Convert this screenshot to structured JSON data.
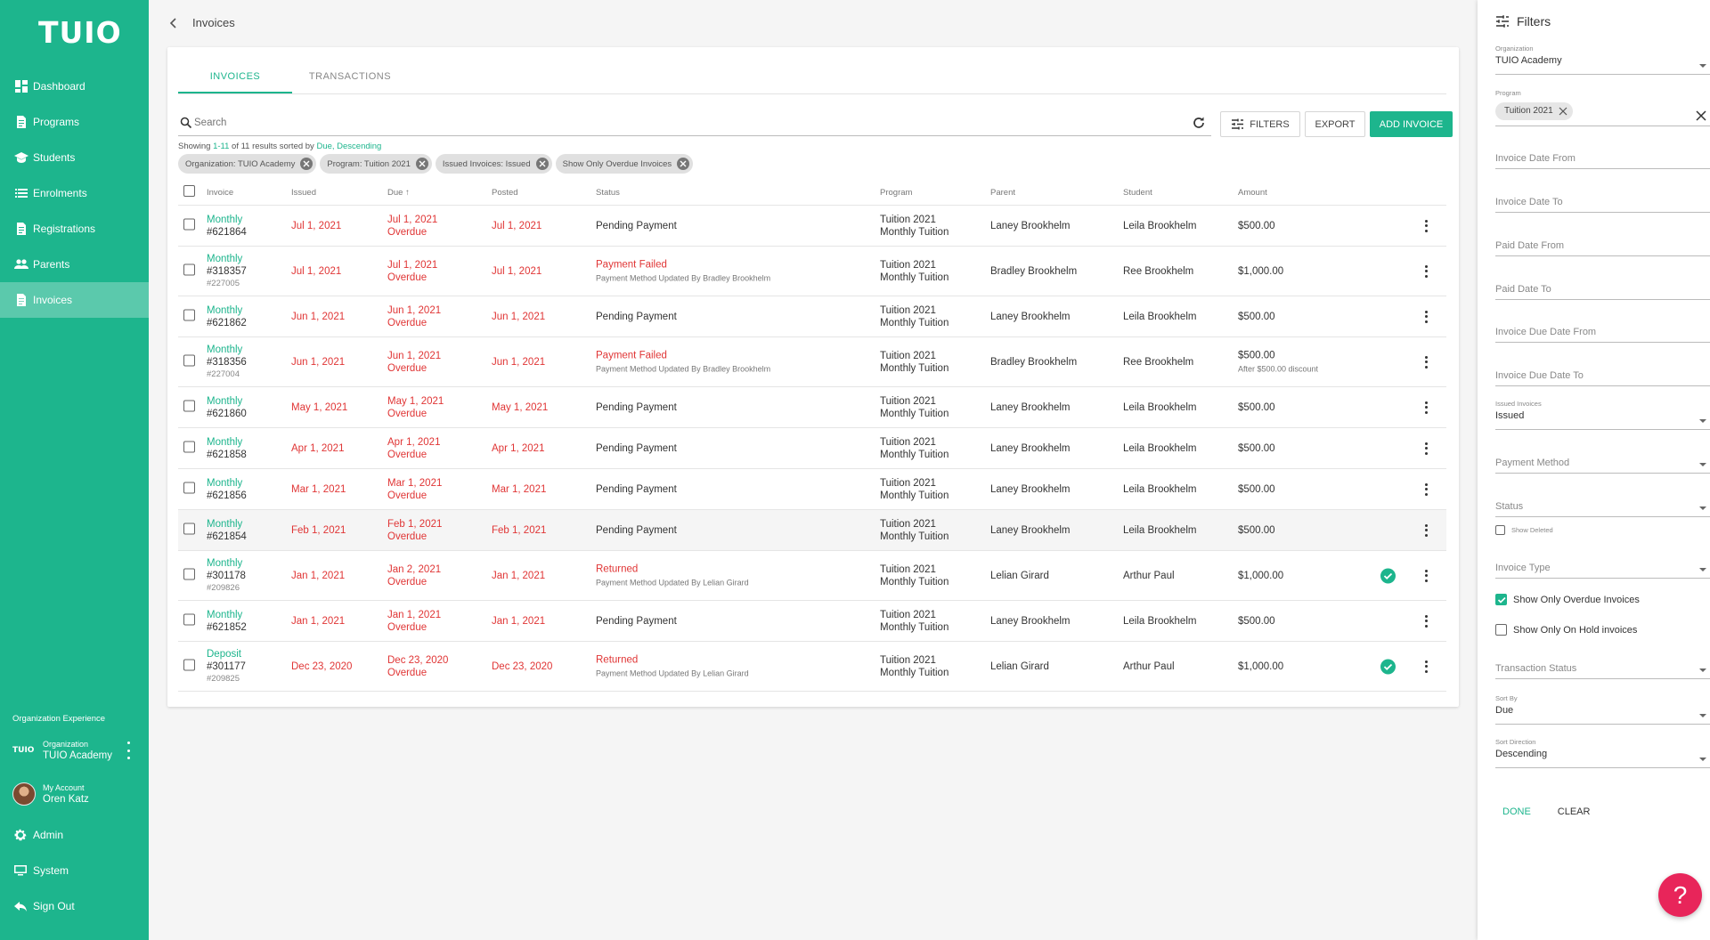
{
  "app": {
    "logo": "TUIO"
  },
  "sidebar": {
    "items": [
      {
        "label": "Dashboard",
        "icon": "dashboard-icon"
      },
      {
        "label": "Programs",
        "icon": "document-icon"
      },
      {
        "label": "Students",
        "icon": "graduation-cap-icon"
      },
      {
        "label": "Enrolments",
        "icon": "list-icon"
      },
      {
        "label": "Registrations",
        "icon": "document-icon"
      },
      {
        "label": "Parents",
        "icon": "people-icon"
      },
      {
        "label": "Invoices",
        "icon": "document-icon",
        "active": true
      }
    ],
    "org_experience": "Organization Experience",
    "org": {
      "logo": "TUIO",
      "label": "Organization",
      "name": "TUIO Academy"
    },
    "account": {
      "label": "My Account",
      "name": "Oren Katz"
    },
    "bottom_items": [
      {
        "label": "Admin",
        "icon": "gear-icon"
      },
      {
        "label": "System",
        "icon": "monitor-icon"
      },
      {
        "label": "Sign Out",
        "icon": "sign-out-icon"
      }
    ]
  },
  "header": {
    "title": "Invoices"
  },
  "tabs": [
    {
      "label": "INVOICES",
      "active": true
    },
    {
      "label": "TRANSACTIONS",
      "active": false
    }
  ],
  "toolbar": {
    "search_placeholder": "Search",
    "filters_label": "FILTERS",
    "export_label": "EXPORT",
    "add_label": "ADD INVOICE"
  },
  "summary": {
    "prefix": "Showing ",
    "range": "1-11",
    "middle": " of 11 results sorted by ",
    "sort": "Due, Descending"
  },
  "chips": [
    "Organization: TUIO Academy",
    "Program: Tuition 2021",
    "Issued Invoices: Issued",
    "Show Only Overdue Invoices"
  ],
  "table": {
    "headers": {
      "invoice": "Invoice",
      "issued": "Issued",
      "due": "Due",
      "posted": "Posted",
      "status": "Status",
      "program": "Program",
      "parent": "Parent",
      "student": "Student",
      "amount": "Amount"
    },
    "rows": [
      {
        "type": "Monthly",
        "number": "#621864",
        "ref": "",
        "issued": "Jul 1, 2021",
        "due": "Jul 1, 2021",
        "due_note": "Overdue",
        "posted": "Jul 1, 2021",
        "status": "Pending Payment",
        "status_red": false,
        "status_note": "",
        "program": "Tuition 2021",
        "program_sub": "Monthly Tuition",
        "parent": "Laney Brookhelm",
        "student": "Leila Brookhelm",
        "amount": "$500.00",
        "amount_note": "",
        "check": false
      },
      {
        "type": "Monthly",
        "number": "#318357",
        "ref": "#227005",
        "issued": "Jul 1, 2021",
        "due": "Jul 1, 2021",
        "due_note": "Overdue",
        "posted": "Jul 1, 2021",
        "status": "Payment Failed",
        "status_red": true,
        "status_note": "Payment Method Updated By Bradley Brookhelm",
        "program": "Tuition 2021",
        "program_sub": "Monthly Tuition",
        "parent": "Bradley Brookhelm",
        "student": "Ree Brookhelm",
        "amount": "$1,000.00",
        "amount_note": "",
        "check": false
      },
      {
        "type": "Monthly",
        "number": "#621862",
        "ref": "",
        "issued": "Jun 1, 2021",
        "due": "Jun 1, 2021",
        "due_note": "Overdue",
        "posted": "Jun 1, 2021",
        "status": "Pending Payment",
        "status_red": false,
        "status_note": "",
        "program": "Tuition 2021",
        "program_sub": "Monthly Tuition",
        "parent": "Laney Brookhelm",
        "student": "Leila Brookhelm",
        "amount": "$500.00",
        "amount_note": "",
        "check": false
      },
      {
        "type": "Monthly",
        "number": "#318356",
        "ref": "#227004",
        "issued": "Jun 1, 2021",
        "due": "Jun 1, 2021",
        "due_note": "Overdue",
        "posted": "Jun 1, 2021",
        "status": "Payment Failed",
        "status_red": true,
        "status_note": "Payment Method Updated By Bradley Brookhelm",
        "program": "Tuition 2021",
        "program_sub": "Monthly Tuition",
        "parent": "Bradley Brookhelm",
        "student": "Ree Brookhelm",
        "amount": "$500.00",
        "amount_note": "After $500.00 discount",
        "check": false
      },
      {
        "type": "Monthly",
        "number": "#621860",
        "ref": "",
        "issued": "May 1, 2021",
        "due": "May 1, 2021",
        "due_note": "Overdue",
        "posted": "May 1, 2021",
        "status": "Pending Payment",
        "status_red": false,
        "status_note": "",
        "program": "Tuition 2021",
        "program_sub": "Monthly Tuition",
        "parent": "Laney Brookhelm",
        "student": "Leila Brookhelm",
        "amount": "$500.00",
        "amount_note": "",
        "check": false
      },
      {
        "type": "Monthly",
        "number": "#621858",
        "ref": "",
        "issued": "Apr 1, 2021",
        "due": "Apr 1, 2021",
        "due_note": "Overdue",
        "posted": "Apr 1, 2021",
        "status": "Pending Payment",
        "status_red": false,
        "status_note": "",
        "program": "Tuition 2021",
        "program_sub": "Monthly Tuition",
        "parent": "Laney Brookhelm",
        "student": "Leila Brookhelm",
        "amount": "$500.00",
        "amount_note": "",
        "check": false
      },
      {
        "type": "Monthly",
        "number": "#621856",
        "ref": "",
        "issued": "Mar 1, 2021",
        "due": "Mar 1, 2021",
        "due_note": "Overdue",
        "posted": "Mar 1, 2021",
        "status": "Pending Payment",
        "status_red": false,
        "status_note": "",
        "program": "Tuition 2021",
        "program_sub": "Monthly Tuition",
        "parent": "Laney Brookhelm",
        "student": "Leila Brookhelm",
        "amount": "$500.00",
        "amount_note": "",
        "check": false
      },
      {
        "type": "Monthly",
        "number": "#621854",
        "ref": "",
        "issued": "Feb 1, 2021",
        "due": "Feb 1, 2021",
        "due_note": "Overdue",
        "posted": "Feb 1, 2021",
        "status": "Pending Payment",
        "status_red": false,
        "status_note": "",
        "program": "Tuition 2021",
        "program_sub": "Monthly Tuition",
        "parent": "Laney Brookhelm",
        "student": "Leila Brookhelm",
        "amount": "$500.00",
        "amount_note": "",
        "check": false,
        "hover": true
      },
      {
        "type": "Monthly",
        "number": "#301178",
        "ref": "#209826",
        "issued": "Jan 1, 2021",
        "due": "Jan 2, 2021",
        "due_note": "Overdue",
        "posted": "Jan 1, 2021",
        "status": "Returned",
        "status_red": true,
        "status_note": "Payment Method Updated By Lelian Girard",
        "program": "Tuition 2021",
        "program_sub": "Monthly Tuition",
        "parent": "Lelian Girard",
        "student": "Arthur Paul",
        "amount": "$1,000.00",
        "amount_note": "",
        "check": true
      },
      {
        "type": "Monthly",
        "number": "#621852",
        "ref": "",
        "issued": "Jan 1, 2021",
        "due": "Jan 1, 2021",
        "due_note": "Overdue",
        "posted": "Jan 1, 2021",
        "status": "Pending Payment",
        "status_red": false,
        "status_note": "",
        "program": "Tuition 2021",
        "program_sub": "Monthly Tuition",
        "parent": "Laney Brookhelm",
        "student": "Leila Brookhelm",
        "amount": "$500.00",
        "amount_note": "",
        "check": false
      },
      {
        "type": "Deposit",
        "number": "#301177",
        "ref": "#209825",
        "issued": "Dec 23, 2020",
        "due": "Dec 23, 2020",
        "due_note": "Overdue",
        "posted": "Dec 23, 2020",
        "status": "Returned",
        "status_red": true,
        "status_note": "Payment Method Updated By Lelian Girard",
        "program": "Tuition 2021",
        "program_sub": "Monthly Tuition",
        "parent": "Lelian Girard",
        "student": "Arthur Paul",
        "amount": "$1,000.00",
        "amount_note": "",
        "check": true
      }
    ]
  },
  "filters": {
    "title": "Filters",
    "organization": {
      "label": "Organization",
      "value": "TUIO Academy"
    },
    "program": {
      "label": "Program",
      "chip": "Tuition 2021"
    },
    "invoice_date_from": "Invoice Date From",
    "invoice_date_to": "Invoice Date To",
    "paid_date_from": "Paid Date From",
    "paid_date_to": "Paid Date To",
    "invoice_due_date_from": "Invoice Due Date From",
    "invoice_due_date_to": "Invoice Due Date To",
    "issued_invoices": {
      "label": "Issued Invoices",
      "value": "Issued"
    },
    "payment_method": "Payment Method",
    "status": "Status",
    "show_deleted": "Show Deleted",
    "invoice_type": "Invoice Type",
    "show_overdue": "Show Only Overdue Invoices",
    "show_on_hold": "Show Only On Hold invoices",
    "transaction_status": "Transaction Status",
    "sort_by": {
      "label": "Sort By",
      "value": "Due"
    },
    "sort_direction": {
      "label": "Sort Direction",
      "value": "Descending"
    },
    "done_label": "DONE",
    "clear_label": "CLEAR"
  },
  "help": {
    "label": "?"
  }
}
